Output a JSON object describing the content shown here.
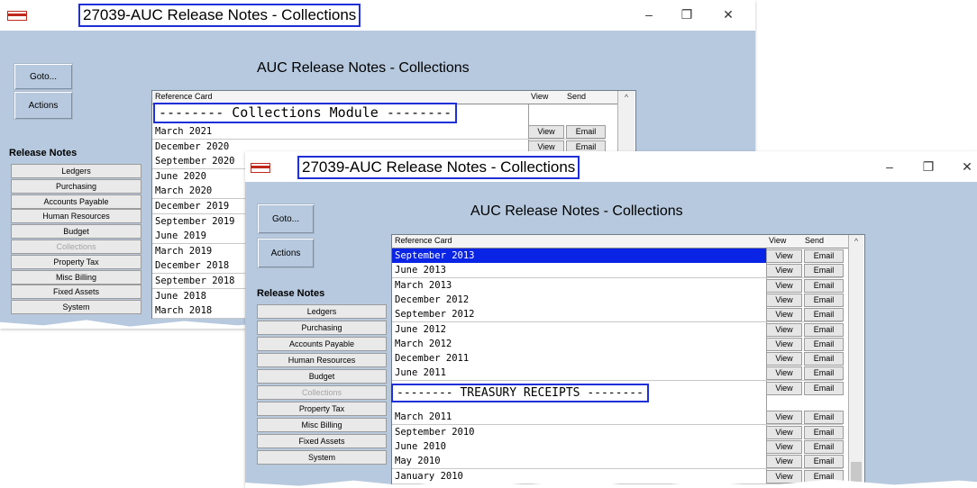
{
  "back_window": {
    "title": "27039-AUC Release Notes - Collections",
    "heading": "AUC Release Notes - Collections",
    "goto_label": "Goto...",
    "actions_label": "Actions",
    "release_notes_title": "Release Notes",
    "nav": [
      "Ledgers",
      "Purchasing",
      "Accounts Payable",
      "Human Resources",
      "Budget",
      "Collections",
      "Property Tax",
      "Misc Billing",
      "Fixed Assets",
      "System"
    ],
    "nav_disabled": "Collections",
    "columns": {
      "ref": "Reference Card",
      "view": "View",
      "send": "Send"
    },
    "separator": "-------- Collections Module --------",
    "rows": [
      "March 2021",
      "December 2020",
      "September 2020",
      "June 2020",
      "March 2020",
      "December 2019",
      "September 2019",
      "June 2019",
      "March 2019",
      "December 2018",
      "September 2018",
      "June 2018",
      "March 2018"
    ],
    "view_label": "View",
    "email_label": "Email"
  },
  "front_window": {
    "title": "27039-AUC Release Notes - Collections",
    "heading": "AUC Release Notes - Collections",
    "goto_label": "Goto...",
    "actions_label": "Actions",
    "release_notes_title": "Release Notes",
    "nav": [
      "Ledgers",
      "Purchasing",
      "Accounts Payable",
      "Human Resources",
      "Budget",
      "Collections",
      "Property Tax",
      "Misc Billing",
      "Fixed Assets",
      "System"
    ],
    "nav_disabled": "Collections",
    "columns": {
      "ref": "Reference Card",
      "view": "View",
      "send": "Send"
    },
    "rows_top": [
      "September 2013",
      "June 2013",
      "March 2013",
      "December 2012",
      "September 2012",
      "June 2012",
      "March 2012",
      "December 2011",
      "June 2011"
    ],
    "separator": "-------- TREASURY RECEIPTS --------",
    "rows_bottom": [
      "March 2011",
      "September 2010",
      "June 2010",
      "May 2010",
      "January 2010"
    ],
    "selected_row": "September 2013",
    "view_label": "View",
    "email_label": "Email"
  },
  "window_controls": {
    "minimize": "–",
    "maximize": "❐",
    "close": "✕"
  },
  "colors": {
    "window_bg": "#b7c9de",
    "highlight_box": "#1f2fd8",
    "selection": "#0a24e6"
  }
}
